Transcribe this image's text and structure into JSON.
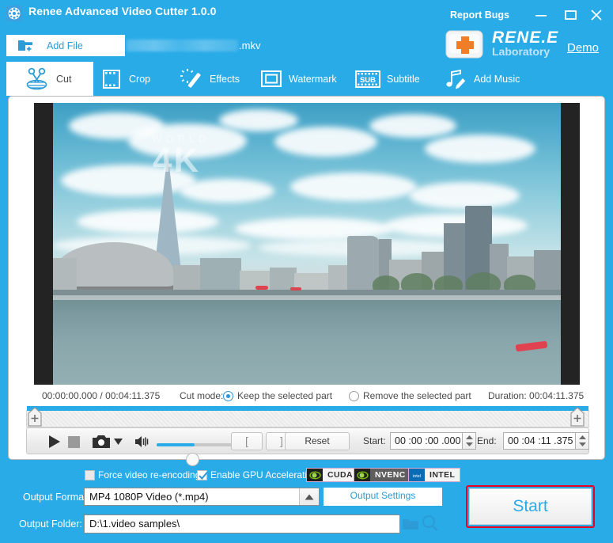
{
  "window": {
    "title": "Renee Advanced Video Cutter 1.0.0",
    "report_bugs": "Report Bugs",
    "minimize_icon": "minimize-icon",
    "maximize_icon": "maximize-icon",
    "close_icon": "close-icon",
    "app_icon": "film-reel-icon"
  },
  "brand": {
    "name_top": "RENE.E",
    "name_bottom": "Laboratory",
    "demo_link": "Demo",
    "logo_icon": "keyboard-key-plus-icon"
  },
  "toolbar": {
    "add_file_label": "Add File",
    "add_file_icon": "add-folder-icon",
    "file_extension": ".mkv"
  },
  "tabs": [
    {
      "label": "Cut",
      "icon": "scissors-icon",
      "active": true
    },
    {
      "label": "Crop",
      "icon": "film-crop-icon",
      "active": false
    },
    {
      "label": "Effects",
      "icon": "magic-wand-icon",
      "active": false
    },
    {
      "label": "Watermark",
      "icon": "frame-icon",
      "active": false
    },
    {
      "label": "Subtitle",
      "icon": "sub-film-icon",
      "active": false
    },
    {
      "label": "Add Music",
      "icon": "music-note-pencil-icon",
      "active": false
    }
  ],
  "preview": {
    "watermark_line1": "WORLD",
    "watermark_line2": "4K"
  },
  "timeline": {
    "current_time": "00:00:00.000 / 00:04:11.375",
    "cut_mode_label": "Cut mode:",
    "keep_label": "Keep the selected part",
    "remove_label": "Remove the selected part",
    "keep_selected": true,
    "remove_selected": false,
    "duration_label": "Duration: 00:04:11.375",
    "handle_left_icon": "trim-handle-icon",
    "handle_right_icon": "trim-handle-icon"
  },
  "controls": {
    "play_icon": "play-icon",
    "stop_icon": "stop-icon",
    "snapshot_icon": "camera-icon",
    "snapshot_dropdown_icon": "caret-down-icon",
    "volume_icon": "speaker-icon",
    "volume_percent": 48,
    "mark_in_label": "[",
    "mark_out_label": "]",
    "reset_label": "Reset",
    "start_label": "Start:",
    "start_value": "00 :00 :00 .000",
    "end_label": "End:",
    "end_value": "00 :04 :11 .375",
    "spinner_icon": "spinner-updown-icon"
  },
  "options": {
    "force_reencode_label": "Force video re-encoding",
    "force_reencode_checked": false,
    "gpu_accel_label": "Enable GPU Acceleration",
    "gpu_accel_checked": true,
    "badges": [
      {
        "text": "CUDA",
        "icon": "nvidia-eye-icon"
      },
      {
        "text": "NVENC",
        "icon": "nvidia-eye-icon"
      },
      {
        "text": "INTEL",
        "icon": "intel-logo-icon"
      }
    ]
  },
  "output": {
    "format_label": "Output Format:",
    "format_value": "MP4 1080P Video (*.mp4)",
    "format_arrow_icon": "caret-up-icon",
    "settings_label": "Output Settings",
    "folder_label": "Output Folder:",
    "folder_value": "D:\\1.video samples\\",
    "browse_folder_icon": "folder-icon",
    "search_icon": "magnifier-icon"
  },
  "action": {
    "start_label": "Start"
  },
  "colors": {
    "brand_blue": "#29ABE8",
    "accent_link": "#2C9BD6",
    "highlight_red": "#E8001E",
    "panel_white": "#FFFFFF"
  }
}
